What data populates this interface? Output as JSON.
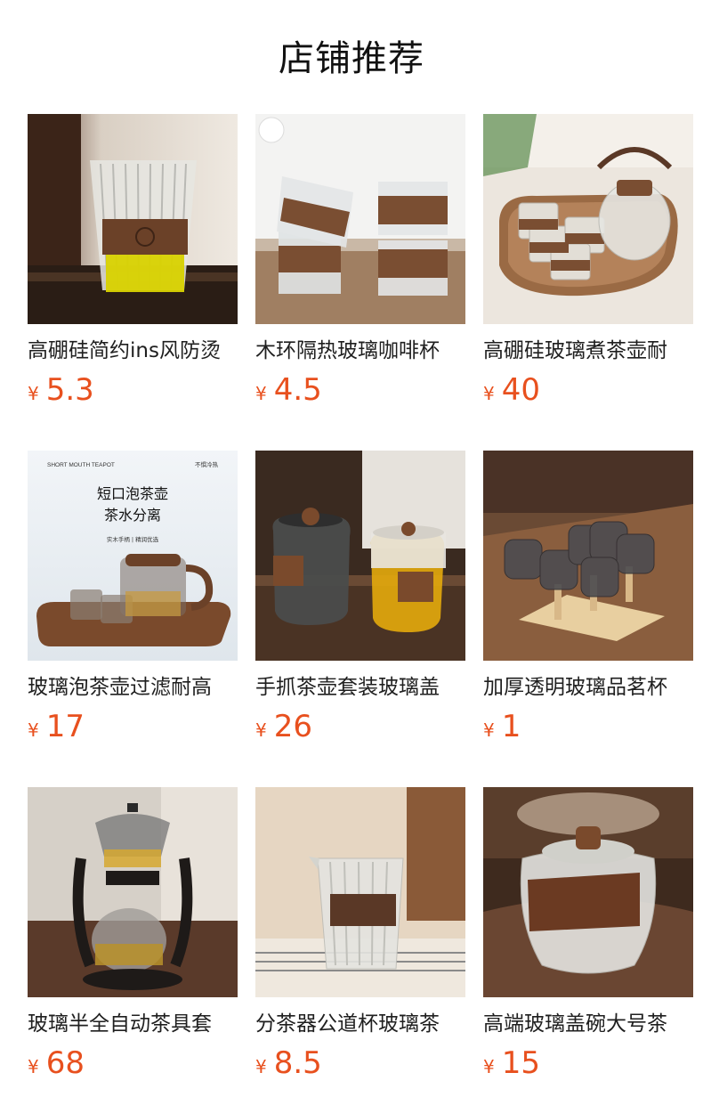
{
  "header": {
    "title": "店铺推荐"
  },
  "currency_symbol": "¥",
  "products": [
    {
      "name": "高硼硅简约ins风防烫",
      "price": "5.3",
      "image_icon": "striped-glass-cup-with-wood-sleeve"
    },
    {
      "name": "木环隔热玻璃咖啡杯",
      "price": "4.5",
      "image_icon": "stacked-glass-cups-wood-band"
    },
    {
      "name": "高硼硅玻璃煮茶壶耐",
      "price": "40",
      "image_icon": "glass-teapot-set-on-tray"
    },
    {
      "name": "玻璃泡茶壶过滤耐高",
      "price": "17",
      "image_icon": "short-mouth-teapot-poster",
      "poster": {
        "top_left": "SHORT MOUTH TEAPOT",
        "top_right": "不惧冷热",
        "line1": "短口泡茶壶",
        "line2": "茶水分离",
        "small": "实木手柄 | 精润优选"
      }
    },
    {
      "name": "手抓茶壶套装玻璃盖",
      "price": "26",
      "image_icon": "grab-handle-teapots"
    },
    {
      "name": "加厚透明玻璃品茗杯",
      "price": "1",
      "image_icon": "cups-on-drying-rack"
    },
    {
      "name": "玻璃半全自动茶具套",
      "price": "68",
      "image_icon": "automatic-tea-maker"
    },
    {
      "name": "分茶器公道杯玻璃茶",
      "price": "8.5",
      "image_icon": "glass-fair-cup"
    },
    {
      "name": "高端玻璃盖碗大号茶",
      "price": "15",
      "image_icon": "glass-gaiwan-bowl"
    }
  ]
}
